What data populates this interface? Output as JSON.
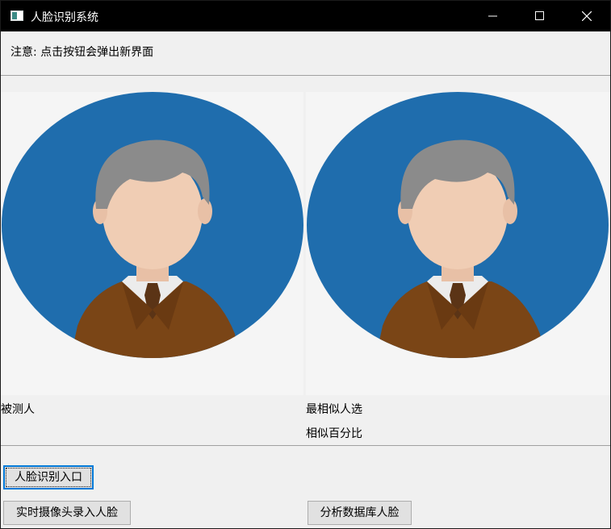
{
  "window": {
    "title": "人脸识别系统"
  },
  "notice": "注意: 点击按钮会弹出新界面",
  "panels": {
    "left_label": "被测人",
    "right_label": "最相似人选",
    "similarity_label": "相似百分比"
  },
  "buttons": {
    "face_recognition": "人脸识别入口",
    "camera_enroll": "实时摄像头录入人脸",
    "analyze_db": "分析数据库人脸"
  },
  "colors": {
    "avatar_bg": "#1f6dad",
    "hair": "#8b8b8b",
    "skin": "#f0cdb4",
    "jacket": "#7a4516",
    "tie": "#5b3416",
    "focus": "#0078d7"
  }
}
